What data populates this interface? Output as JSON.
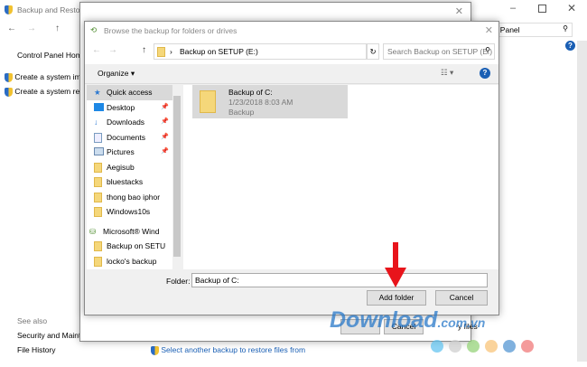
{
  "control_panel": {
    "title": "Backup and Restore",
    "search_text": "rol Panel",
    "sidebar": {
      "home": "Control Panel Hom",
      "links": [
        "Create a system ima",
        "Create a system rep"
      ]
    },
    "see_also": {
      "heading": "See also",
      "links": [
        "Security and Mainte",
        "File History"
      ]
    },
    "restore_link": "Select another backup to restore files from"
  },
  "restore_dialog": {
    "buttons": {
      "cancel": "Cancel",
      "restore_files": "y files"
    }
  },
  "browse_dialog": {
    "title": "Browse the backup for folders or drives",
    "address": "Backup on SETUP (E:)",
    "search_placeholder": "Search Backup on SETUP (E:)",
    "organize": "Organize",
    "nav": {
      "quick_access": "Quick access",
      "items": [
        {
          "label": "Desktop",
          "icon": "desktop-icon",
          "pinned": true
        },
        {
          "label": "Downloads",
          "icon": "download-icon",
          "pinned": true
        },
        {
          "label": "Documents",
          "icon": "documents-icon",
          "pinned": true
        },
        {
          "label": "Pictures",
          "icon": "pictures-icon",
          "pinned": true
        },
        {
          "label": "Aegisub",
          "icon": "folder-icon"
        },
        {
          "label": "bluestacks",
          "icon": "folder-icon"
        },
        {
          "label": "thong bao iphor",
          "icon": "folder-icon"
        },
        {
          "label": "Windows10s",
          "icon": "folder-icon"
        }
      ],
      "drive": "Microsoft® Wind",
      "drive_items": [
        "Backup on SETU",
        "locko's backup"
      ]
    },
    "content": {
      "item": {
        "name": "Backup of C:",
        "date": "1/23/2018 8:03 AM",
        "type": "Backup"
      }
    },
    "folder_label": "Folder:",
    "folder_value": "Backup of C:",
    "add_folder": "Add folder",
    "cancel": "Cancel"
  },
  "watermark": "Download.com.vn",
  "colors": {
    "arrow": "#e8141b",
    "link": "#1a5fb4",
    "selected": "#d9d9d9"
  }
}
